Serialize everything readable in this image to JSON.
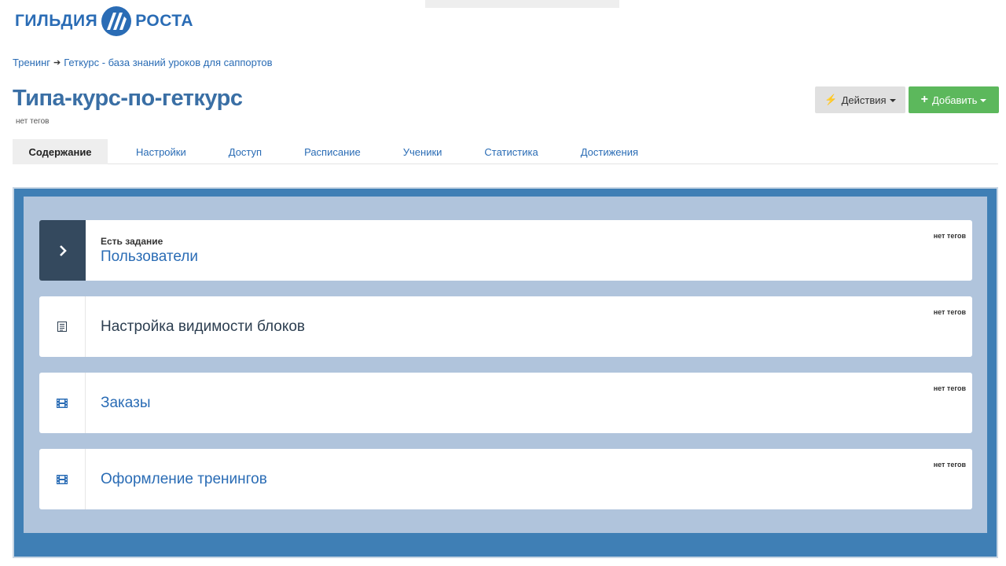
{
  "brand": {
    "name_left": "ГИЛЬДИЯ",
    "name_right": "РОСТА"
  },
  "breadcrumb": {
    "items": [
      "Тренинг",
      "Геткурс - база знаний уроков для саппортов"
    ]
  },
  "page": {
    "title": "Типа-курс-по-геткурс",
    "tags": "нет тегов"
  },
  "actions": {
    "actions_label": "Действия",
    "add_label": "Добавить"
  },
  "tabs": [
    {
      "label": "Содержание",
      "active": true
    },
    {
      "label": "Настройки"
    },
    {
      "label": "Доступ"
    },
    {
      "label": "Расписание"
    },
    {
      "label": "Ученики"
    },
    {
      "label": "Статистика"
    },
    {
      "label": "Достижения"
    }
  ],
  "lessons": [
    {
      "subtitle": "Есть задание",
      "title": "Пользователи",
      "tags": "нет тегов",
      "icon": "chevron-right-icon"
    },
    {
      "subtitle": "",
      "title": "Настройка видимости блоков",
      "tags": "нет тегов",
      "icon": "document-icon"
    },
    {
      "subtitle": "",
      "title": "Заказы",
      "tags": "нет тегов",
      "icon": "film-icon"
    },
    {
      "subtitle": "",
      "title": "Оформление тренингов",
      "tags": "нет тегов",
      "icon": "film-icon"
    }
  ],
  "colors": {
    "brand_blue": "#2a6cb5",
    "frame_blue": "#3f7fb5",
    "inner_blue": "#b0c4dc",
    "add_green": "#5cb85c",
    "dark_icon_bg": "#34495e"
  }
}
